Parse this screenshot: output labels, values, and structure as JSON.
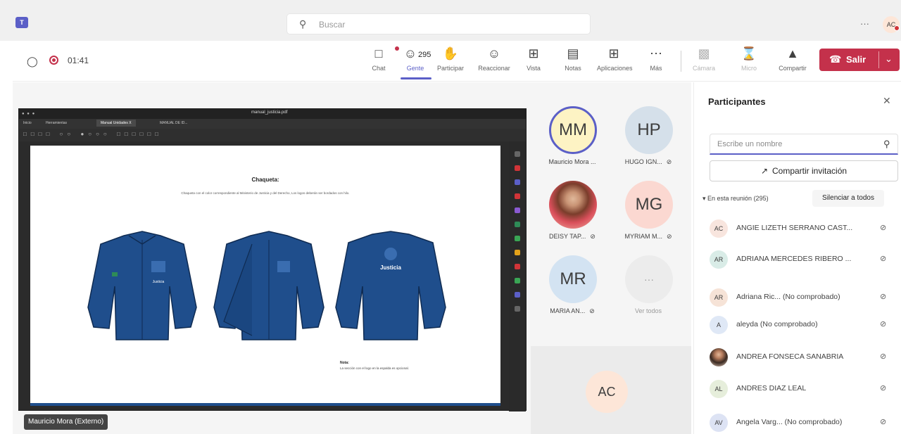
{
  "app": {
    "search_placeholder": "Buscar",
    "more": "···",
    "user_initials": "AC"
  },
  "meeting": {
    "timer": "01:41",
    "toolbar": [
      {
        "id": "chat",
        "label": "Chat",
        "icon": "chat-icon"
      },
      {
        "id": "gente",
        "label": "Gente",
        "icon": "people-icon",
        "count": "295"
      },
      {
        "id": "participar",
        "label": "Participar",
        "icon": "raise-hand-icon"
      },
      {
        "id": "reaccionar",
        "label": "Reaccionar",
        "icon": "emoji-icon"
      },
      {
        "id": "vista",
        "label": "Vista",
        "icon": "grid-icon"
      },
      {
        "id": "notas",
        "label": "Notas",
        "icon": "notes-icon"
      },
      {
        "id": "aplicaciones",
        "label": "Aplicaciones",
        "icon": "apps-icon"
      },
      {
        "id": "mas",
        "label": "Más",
        "icon": "more-icon"
      },
      {
        "id": "camara",
        "label": "Cámara",
        "icon": "camera-off-icon"
      },
      {
        "id": "micro",
        "label": "Micro",
        "icon": "mic-off-icon"
      },
      {
        "id": "compartir",
        "label": "Compartir",
        "icon": "share-screen-icon"
      }
    ],
    "leave_label": "Salir",
    "accent": "#5b5fc7",
    "leave_color": "#c4314b"
  },
  "shared_screen": {
    "title": "manual_justicia.pdf",
    "tabs": [
      "Inicio",
      "Herramientas",
      "Manual Unidades X",
      "MANUAL DE ID..."
    ],
    "doc_title": "Chaqueta:",
    "doc_description": "Chaqueta con el color correspondiente al Ministerio de Justicia y del Derecho, Los logos deberán ser bordados con hilo.",
    "logo_text": "Justicia",
    "note_title": "Nota:",
    "note_text": "La sección con el logo en la espalda es opcional.",
    "presenter_label": "Mauricio Mora (Externo)"
  },
  "gallery": [
    {
      "initials": "MM",
      "name": "Mauricio Mora ...",
      "muted": false,
      "speaking": true,
      "color": "#fdf3c4"
    },
    {
      "initials": "HP",
      "name": "HUGO IGN...",
      "muted": true,
      "speaking": false,
      "color": "#d5e0ea"
    },
    {
      "initials": "",
      "name": "DEISY TAP...",
      "muted": true,
      "speaking": false,
      "photo": true
    },
    {
      "initials": "MG",
      "name": "MYRIAM M...",
      "muted": true,
      "speaking": false,
      "color": "#fbd8d1"
    },
    {
      "initials": "MR",
      "name": "MARIA AN...",
      "muted": true,
      "speaking": false,
      "color": "#d3e3f2"
    },
    {
      "initials": "···",
      "name": "Ver todos",
      "muted": false,
      "speaking": false,
      "more": true
    }
  ],
  "self_tile": {
    "initials": "AC"
  },
  "participants_panel": {
    "title": "Participantes",
    "search_placeholder": "Escribe un nombre",
    "invite_label": "Compartir invitación",
    "section_label": "▾ En esta reunión (295)",
    "mute_all_label": "Silenciar a todos",
    "rows": [
      {
        "initials": "AC",
        "name": "ANGIE LIZETH SERRANO CAST...",
        "color": "#f8e5de"
      },
      {
        "initials": "AR",
        "name": "ADRIANA MERCEDES RIBERO ...",
        "color": "#d9ece7"
      },
      {
        "initials": "AR",
        "name": "Adriana Ric... (No comprobado)",
        "color": "#f6e3d7"
      },
      {
        "initials": "A",
        "name": "aleyda (No comprobado)",
        "color": "#dfe8f6"
      },
      {
        "initials": "",
        "name": "ANDREA FONSECA SANABRIA",
        "photo": true
      },
      {
        "initials": "AL",
        "name": "ANDRES DIAZ LEAL",
        "color": "#e6eedb"
      },
      {
        "initials": "AV",
        "name": "Angela Varg... (No comprobado)",
        "color": "#dde3f4"
      }
    ]
  }
}
